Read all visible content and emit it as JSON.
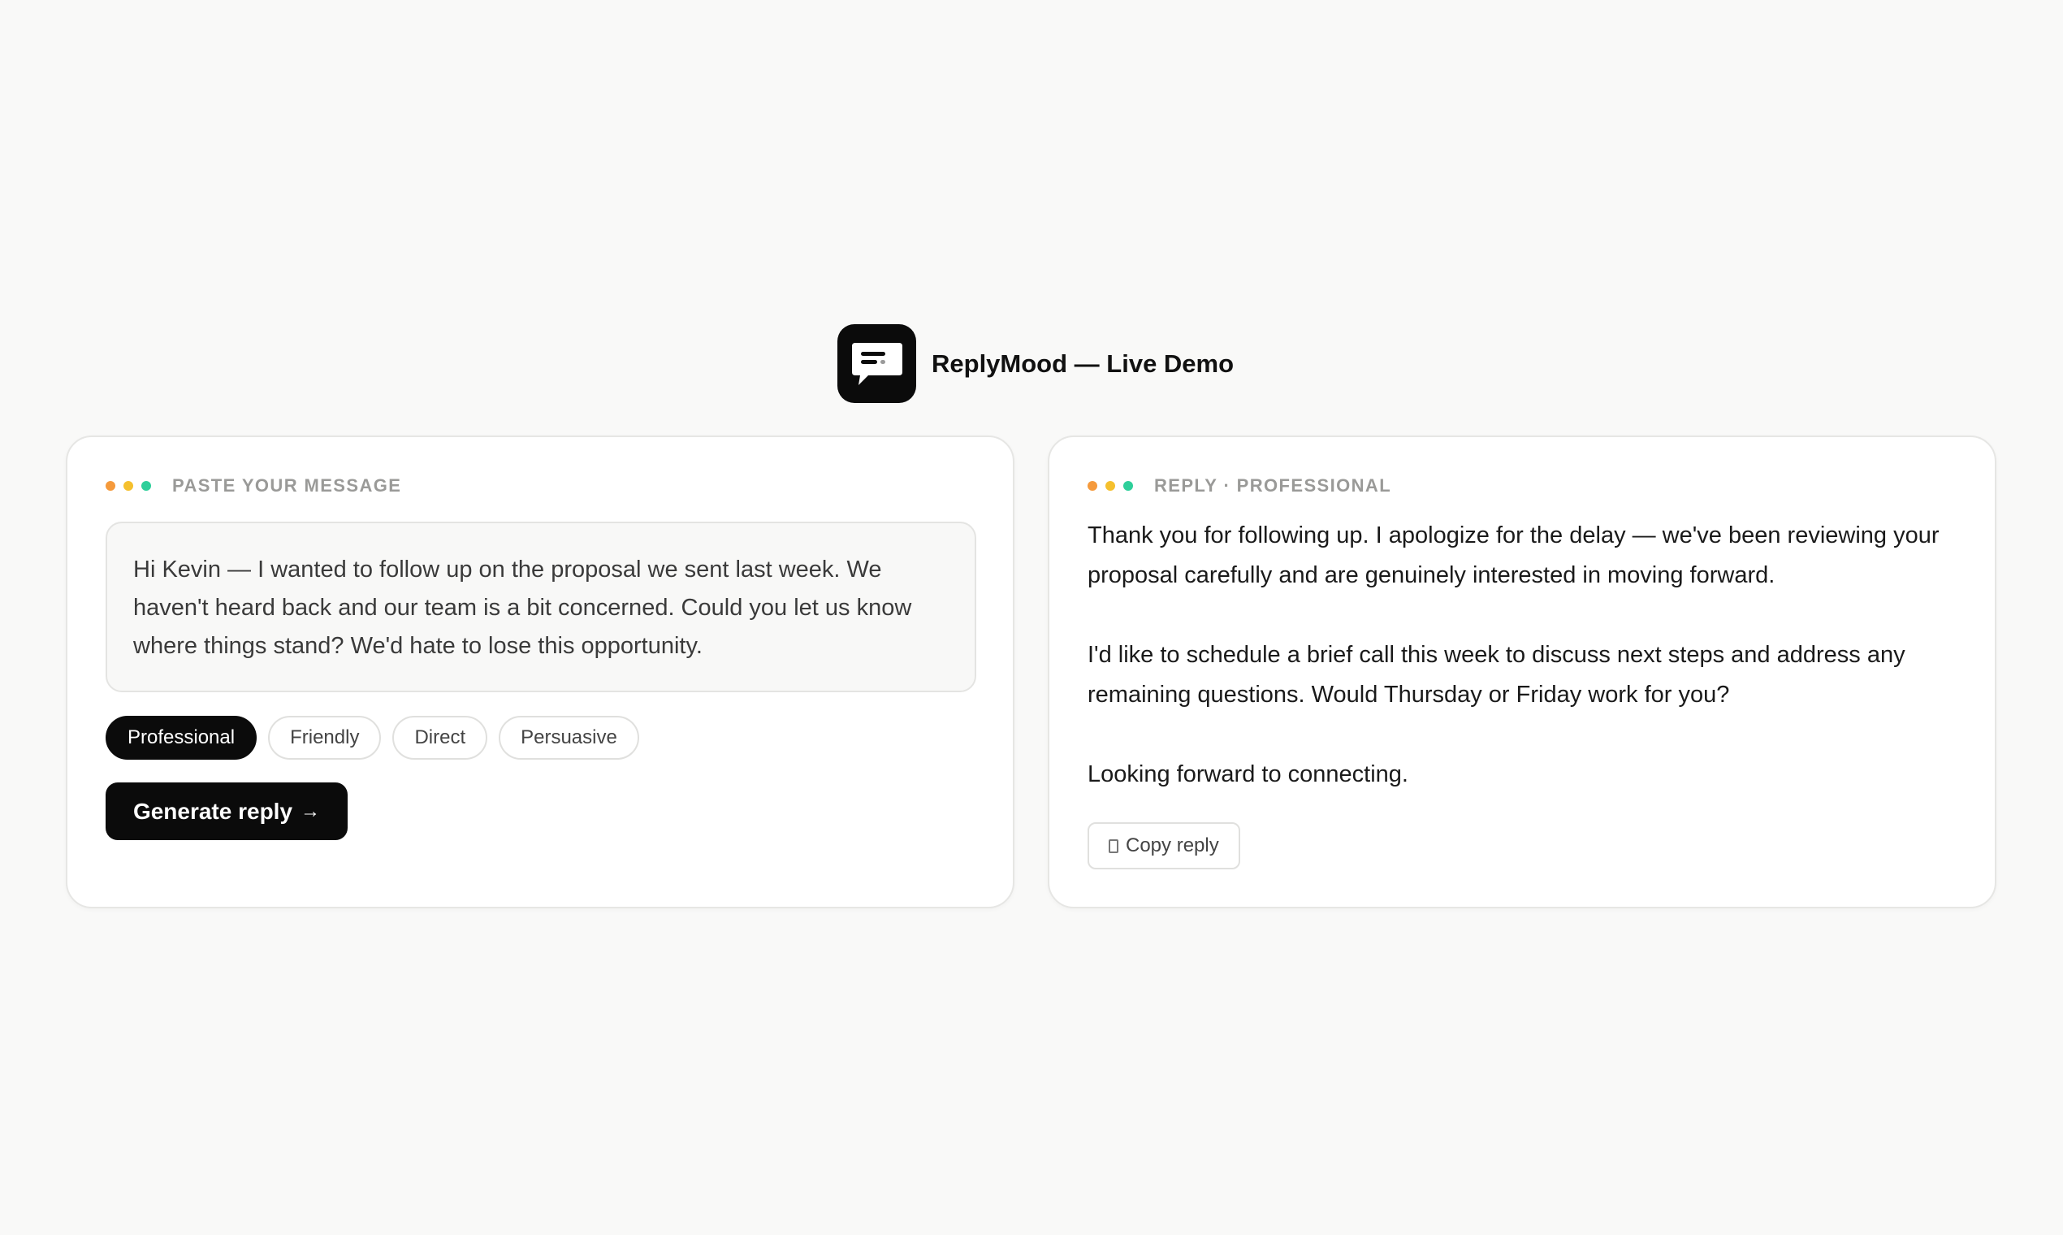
{
  "app": {
    "title": "ReplyMood — Live Demo",
    "logo_icon": "chat-bubble-icon"
  },
  "colors": {
    "accent": "#0b0b0b",
    "dot_orange": "#f59a3c",
    "dot_yellow": "#f5c02e",
    "dot_green": "#2ecf9a"
  },
  "input_panel": {
    "label": "PASTE YOUR MESSAGE",
    "message": "Hi Kevin — I wanted to follow up on the proposal we sent last week. We haven't heard back and our team is a bit concerned. Could you let us know where things stand? We'd hate to lose this opportunity.",
    "tones": [
      "Professional",
      "Friendly",
      "Direct",
      "Persuasive"
    ],
    "selected_tone": "Professional",
    "generate_label": "Generate reply",
    "generate_arrow": "→"
  },
  "reply_panel": {
    "label": "REPLY · PROFESSIONAL",
    "paragraphs": [
      "Thank you for following up. I apologize for the delay — we've been reviewing your proposal carefully and are genuinely interested in moving forward.",
      "I'd like to schedule a brief call this week to discuss next steps and address any remaining questions. Would Thursday or Friday work for you?",
      "Looking forward to connecting."
    ],
    "copy_label": "Copy reply",
    "copy_icon": "copy-icon"
  }
}
